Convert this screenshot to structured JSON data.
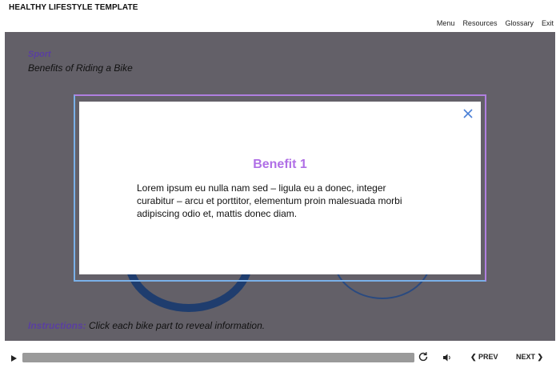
{
  "course": {
    "title": "HEALTHY LIFESTYLE TEMPLATE"
  },
  "top_nav": {
    "menu": "Menu",
    "resources": "Resources",
    "glossary": "Glossary",
    "exit": "Exit"
  },
  "slide": {
    "section": "Sport",
    "subtitle": "Benefits of Riding a Bike",
    "instructions_lead": "Instructions:",
    "instructions_text": " Click each bike part to reveal information."
  },
  "modal": {
    "title": "Benefit 1",
    "body": "Lorem ipsum eu nulla nam sed – ligula eu a donec, integer curabitur – arcu et porttitor, elementum proin malesuada morbi adipiscing odio et, mattis donec diam."
  },
  "player": {
    "prev_label": "PREV",
    "next_label": "NEXT",
    "progress": 1.0
  },
  "colors": {
    "accent": "#b06fe6",
    "overlay": "#636068",
    "section": "#5a3fa0"
  }
}
